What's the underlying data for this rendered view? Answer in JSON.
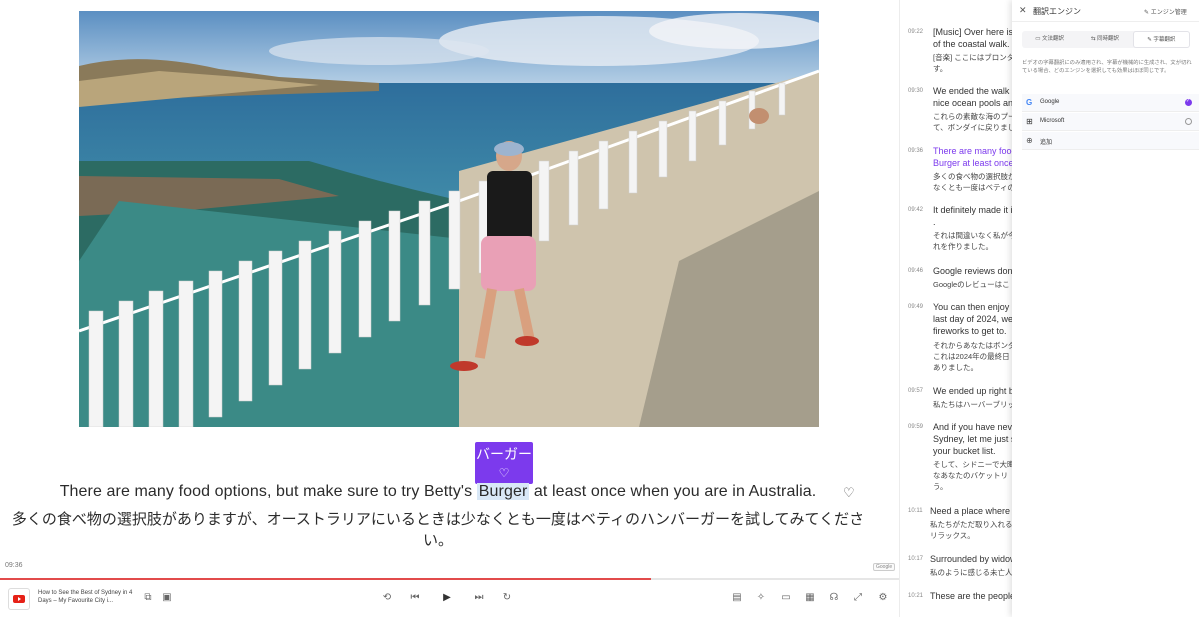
{
  "subtitles": {
    "popup_word": "バーガー",
    "en_before": "There are many food options, but make sure to try Betty's ",
    "en_highlight": "Burger",
    "en_after": " at least once when you are in Australia.",
    "ja": "多くの食べ物の選択肢がありますが、オーストラリアにいるときは少なくとも一度はベティのハンバーガーを試してみてください。"
  },
  "player": {
    "current_time": "09:36",
    "engine_badge": "Google",
    "progress": 0.724,
    "video_title": "How to See the Best of Sydney in 4 Days – My Favourite City i..."
  },
  "transcript": [
    {
      "time": "09:22",
      "en": "[Music] Over here is\nof the coastal walk.",
      "ja": "[音楽] ここにはブロンタ\nす。",
      "active": false
    },
    {
      "time": "09:30",
      "en": "We ended the walk a\nnice ocean pools and",
      "ja": "これらの素敵な海のプー\nて、ボンダイに戻りまし",
      "active": false
    },
    {
      "time": "09:36",
      "en": "There are many food\nBurger at least once",
      "ja": "多くの食べ物の選択肢が\nなくとも一度はベティの",
      "active": true
    },
    {
      "time": "09:42",
      "en": "It definitely made it i\n.",
      "ja": "それは間違いなく私が今\nれを作りました。",
      "active": false
    },
    {
      "time": "09:46",
      "en": "Google reviews don'",
      "ja": "Googleのレビューはこ",
      "active": false
    },
    {
      "time": "09:49",
      "en": "You can then enjoy B\nlast day of 2024, we\nfireworks to get to.",
      "ja": "それからあなたはボンダ\nこれは2024年の最終日\nありました。",
      "active": false
    },
    {
      "time": "09:57",
      "en": "We ended up right b",
      "ja": "私たちはハーバーブリッ",
      "active": false
    },
    {
      "time": "09:59",
      "en": "And if you have neve\nSydney, let me just s\nyour bucket list.",
      "ja": "そして、シドニーで大晦\nなあなたのバケットリ\nう。",
      "active": false
    },
    {
      "time": "10:11",
      "en": "Need a place where y",
      "ja": "私たちがただ取り入れる\nリラックス。",
      "active": false
    },
    {
      "time": "10:17",
      "en": "Surrounded by widow",
      "ja": "私のように感じる未亡人",
      "active": false
    },
    {
      "time": "10:21",
      "en": "These are the people",
      "ja": "",
      "active": false
    }
  ],
  "panel": {
    "title": "翻訳エンジン",
    "manage": "エンジン管理",
    "tabs": [
      "文法翻訳",
      "同時翻訳",
      "字幕翻訳"
    ],
    "selected_tab": 2,
    "description": "ビデオの字幕翻訳にのみ適用され、字幕が機械的に生成され、文が切れている場合、どのエンジンを選択しても効果はほぼ同じです。",
    "engines": [
      {
        "name": "Google",
        "selected": true,
        "icon": "google-icon"
      },
      {
        "name": "Microsoft",
        "selected": false,
        "icon": "windows-icon"
      },
      {
        "name": "追加",
        "selected": false,
        "icon": "add-icon"
      }
    ]
  },
  "colors": {
    "accent": "#7c3aed",
    "progress": "#e24b4b"
  }
}
